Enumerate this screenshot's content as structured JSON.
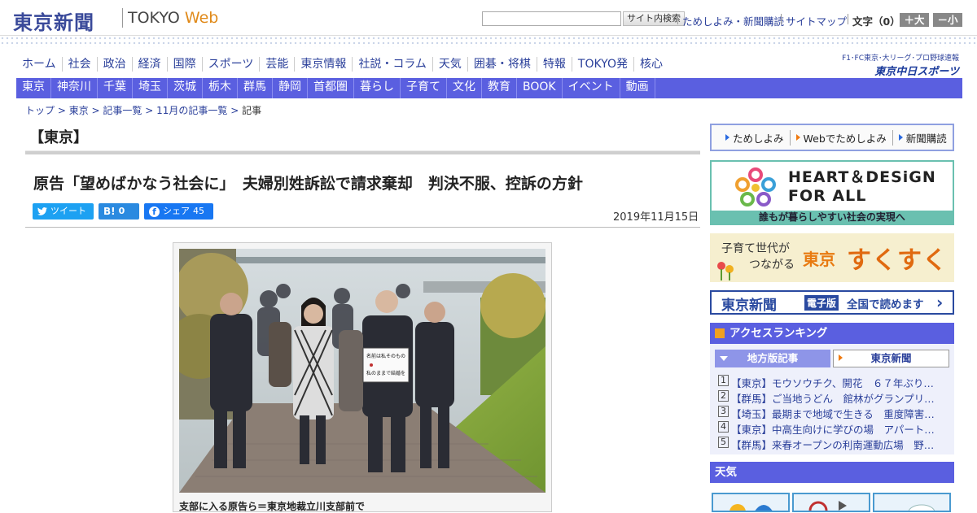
{
  "header": {
    "logo_text": "東京新聞",
    "tokyo_label": "TOKYO",
    "web_label": "Web",
    "search_button": "サイト内検索",
    "links": [
      "ためしよみ・新聞購読",
      "サイトマップ"
    ],
    "font_size_label": "文字（0）",
    "font_larger": "＋大",
    "font_smaller": "－小"
  },
  "main_nav": [
    "ホーム",
    "社会",
    "政治",
    "経済",
    "国際",
    "スポーツ",
    "芸能",
    "東京情報",
    "社説・コラム",
    "天気",
    "囲碁・将棋",
    "特報",
    "TOKYO発",
    "核心"
  ],
  "sports_link": {
    "line1": "F1･FC東京･大リーグ･プロ野球速報",
    "line2": "東京中日スポーツ"
  },
  "local_nav": [
    "東京",
    "神奈川",
    "千葉",
    "埼玉",
    "茨城",
    "栃木",
    "群馬",
    "静岡",
    "首都圏",
    "暮らし",
    "子育て",
    "文化",
    "教育",
    "BOOK",
    "イベント",
    "動画"
  ],
  "breadcrumb": [
    "トップ",
    "東京",
    "記事一覧",
    "11月の記事一覧",
    "記事"
  ],
  "section_title": "【東京】",
  "article": {
    "headline": "原告「望めばかなう社会に」　夫婦別姓訴訟で請求棄却　判決不服、控訴の方針",
    "date": "2019年11月15日",
    "photo_caption": "支部に入る原告ら＝東京地裁立川支部前で",
    "sign_text": [
      "名前は私そのもの",
      "私のままで結婚を"
    ]
  },
  "share": {
    "tweet": "ツイート",
    "hatena_count": "0",
    "facebook": "シェア",
    "facebook_count": "45"
  },
  "sidebar": {
    "trial_links": [
      "ためしよみ",
      "Webでためしよみ",
      "新聞購読"
    ],
    "heart_title_line1": "HEART＆DESiGN",
    "heart_title_line2": "FOR ALL",
    "heart_subtitle": "誰もが暮らしやすい社会の実現へ",
    "suku_small1": "子育て世代が",
    "suku_small2": "つながる",
    "suku_tokyo": "東京",
    "suku_big": "すくすく",
    "digital_logo": "東京新聞",
    "digital_badge": "電子版",
    "digital_text": "全国で読めます",
    "ranking_title": "アクセスランキング",
    "ranking_tab_local": "地方版記事",
    "ranking_tab_tokyo": "東京新聞",
    "ranking": [
      {
        "n": "1",
        "text": "【東京】モウソウチク、開花　６７年ぶり…"
      },
      {
        "n": "2",
        "text": "【群馬】ご当地うどん　館林がグランプリ…"
      },
      {
        "n": "3",
        "text": "【埼玉】最期まで地域で生きる　重度障害…"
      },
      {
        "n": "4",
        "text": "【東京】中高生向けに学びの場　アパート…"
      },
      {
        "n": "5",
        "text": "【群馬】来春オープンの利南運動広場　野…"
      }
    ],
    "weather_title": "天気"
  },
  "colors": {
    "nav_blue": "#5a5fe0",
    "link_blue": "#2a3f9a",
    "accent_orange": "#e08a1a",
    "teal": "#6ac0b0"
  }
}
